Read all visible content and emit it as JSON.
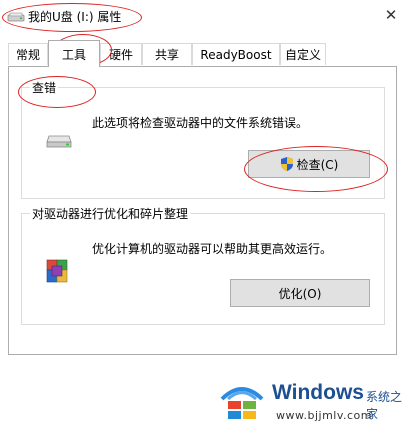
{
  "window": {
    "title": "我的U盘 (I:) 属性",
    "close_glyph": "✕"
  },
  "tabs": [
    {
      "label": "常规",
      "active": false
    },
    {
      "label": "工具",
      "active": true
    },
    {
      "label": "硬件",
      "active": false
    },
    {
      "label": "共享",
      "active": false
    },
    {
      "label": "ReadyBoost",
      "active": false
    },
    {
      "label": "自定义",
      "active": false
    }
  ],
  "error_check": {
    "title": "查错",
    "description": "此选项将检查驱动器中的文件系统错误。",
    "button_label": "检查(C)",
    "icon": "drive-icon"
  },
  "optimize": {
    "title": "对驱动器进行优化和碎片整理",
    "description": "优化计算机的驱动器可以帮助其更高效运行。",
    "button_label": "优化(O)",
    "icon": "defrag-icon"
  },
  "watermark": {
    "brand": "Windows",
    "cn_text": "系统之家",
    "url": "www.bjjmlv.com"
  },
  "colors": {
    "annotation": "#dd2222",
    "brand_blue": "#1d4f91",
    "button_bg": "#e1e1e1"
  }
}
